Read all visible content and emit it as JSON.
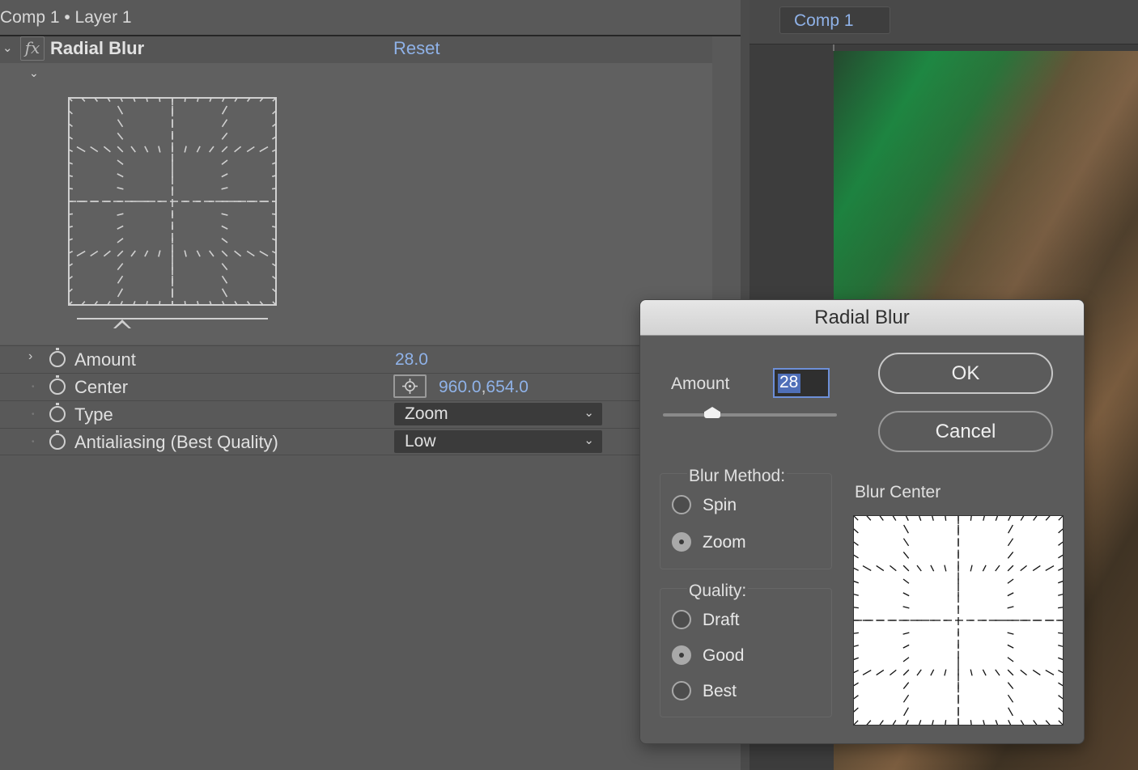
{
  "effect_controls": {
    "panel_title": "Comp 1 • Layer 1",
    "effect": {
      "name": "Radial Blur",
      "fx_badge": "fx",
      "reset_label": "Reset"
    },
    "properties": [
      {
        "label": "Amount",
        "value": "28.0"
      },
      {
        "label": "Center",
        "value_x": "960.0",
        "separator": ",",
        "value_y": "654.0"
      },
      {
        "label": "Type",
        "value": "Zoom"
      },
      {
        "label": "Antialiasing (Best Quality)",
        "value": "Low"
      }
    ]
  },
  "composition": {
    "tab_label": "Comp 1"
  },
  "dialog": {
    "title": "Radial Blur",
    "amount_label": "Amount",
    "amount_value": "28",
    "ok_label": "OK",
    "cancel_label": "Cancel",
    "blur_method": {
      "title": "Blur Method:",
      "options": [
        "Spin",
        "Zoom"
      ],
      "selected": "Zoom"
    },
    "quality": {
      "title": "Quality:",
      "options": [
        "Draft",
        "Good",
        "Best"
      ],
      "selected": "Good"
    },
    "blur_center_label": "Blur Center"
  },
  "colors": {
    "accent_link": "#8fb2e8",
    "panel_bg": "#595959",
    "dialog_bg": "#5b5b5b",
    "dropdown_bg": "#3b3b3b"
  },
  "icons": [
    "chevron-down-icon",
    "fx-icon",
    "stopwatch-icon",
    "chevron-right-icon",
    "crosshair-icon",
    "caret-down-icon"
  ]
}
